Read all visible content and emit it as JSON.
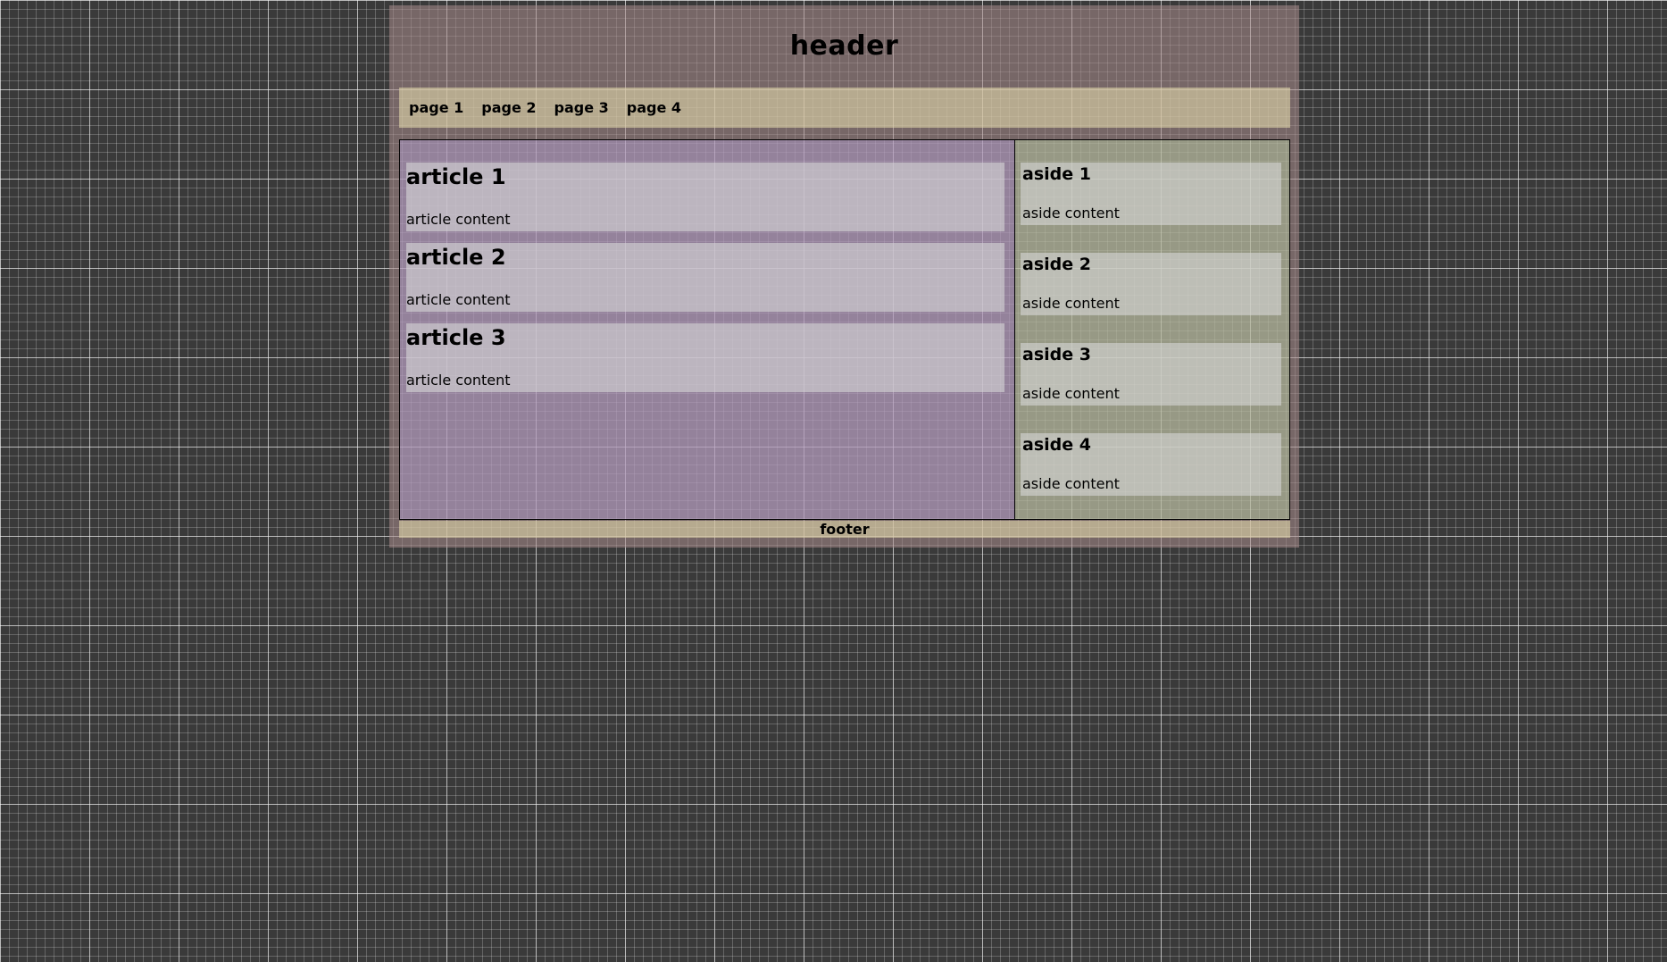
{
  "header": {
    "title": "header"
  },
  "nav": {
    "items": [
      {
        "label": "page 1"
      },
      {
        "label": "page 2"
      },
      {
        "label": "page 3"
      },
      {
        "label": "page 4"
      }
    ]
  },
  "main": {
    "articles": [
      {
        "title": "article 1",
        "content": "article content"
      },
      {
        "title": "article 2",
        "content": "article content"
      },
      {
        "title": "article 3",
        "content": "article content"
      }
    ]
  },
  "aside": {
    "items": [
      {
        "title": "aside 1",
        "content": "aside content"
      },
      {
        "title": "aside 2",
        "content": "aside content"
      },
      {
        "title": "aside 3",
        "content": "aside content"
      },
      {
        "title": "aside 4",
        "content": "aside content"
      }
    ]
  },
  "footer": {
    "text": "footer"
  }
}
